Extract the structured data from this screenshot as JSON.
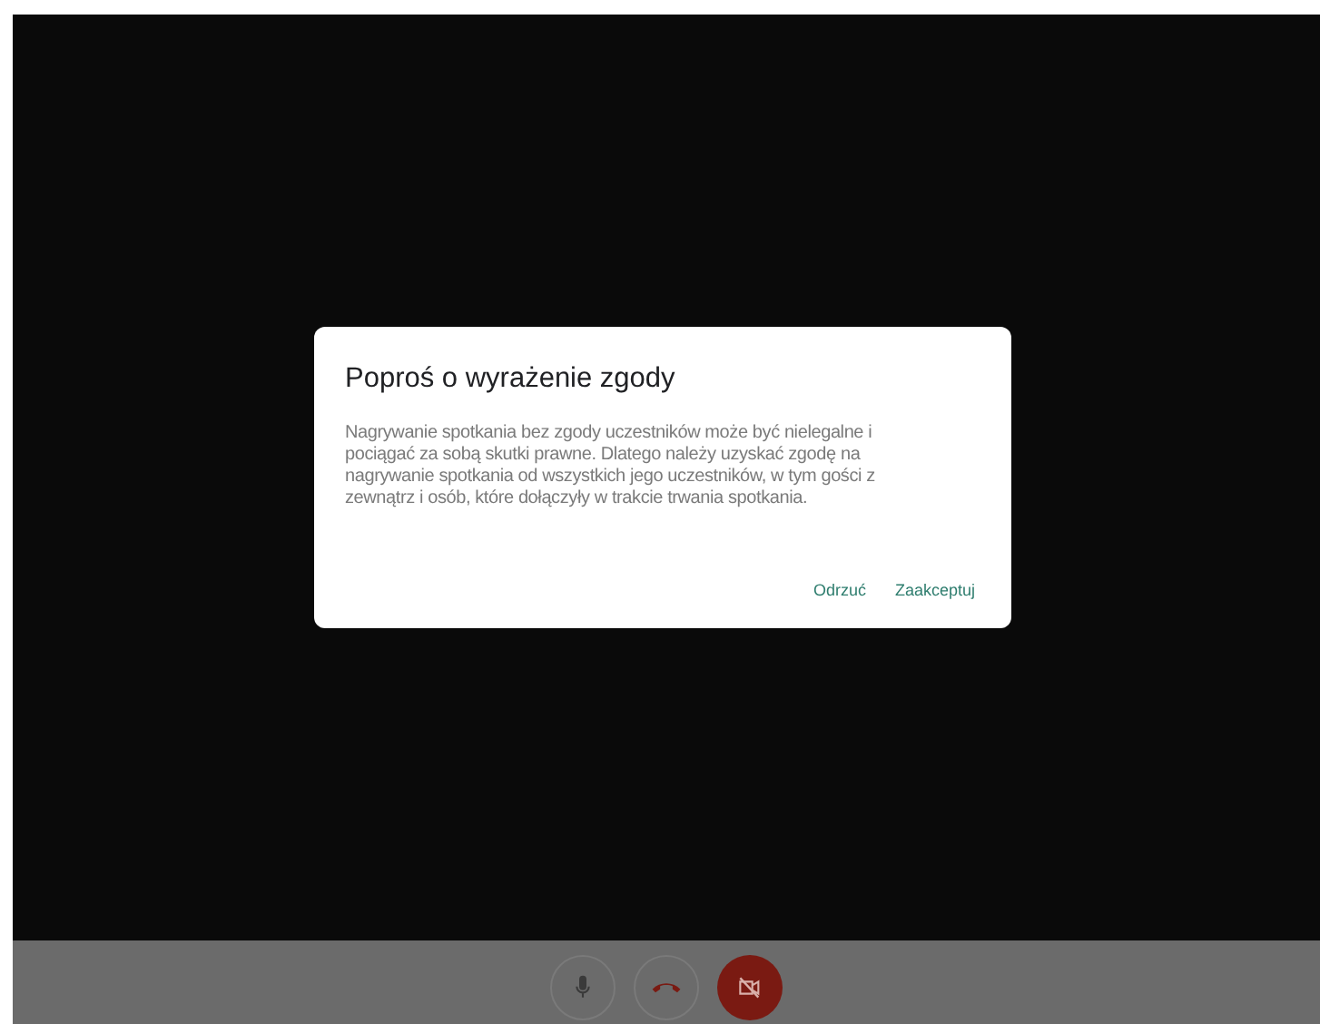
{
  "dialog": {
    "title": "Poproś o wyrażenie zgody",
    "body": "Nagrywanie spotkania bez zgody uczestników może być nielegalne i pociągać za sobą skutki prawne. Dlatego należy uzyskać zgodę na nagrywanie spotkania od wszystkich jego uczestników, w tym gości z zewnątrz i osób, które dołączyły w trakcie trwania spotkania.",
    "buttons": [
      "Odrzuć",
      "Zaakceptuj"
    ]
  },
  "controls": [
    {
      "kind": "microphone",
      "on": true
    },
    {
      "kind": "hangup"
    },
    {
      "kind": "camera",
      "on": false
    }
  ]
}
